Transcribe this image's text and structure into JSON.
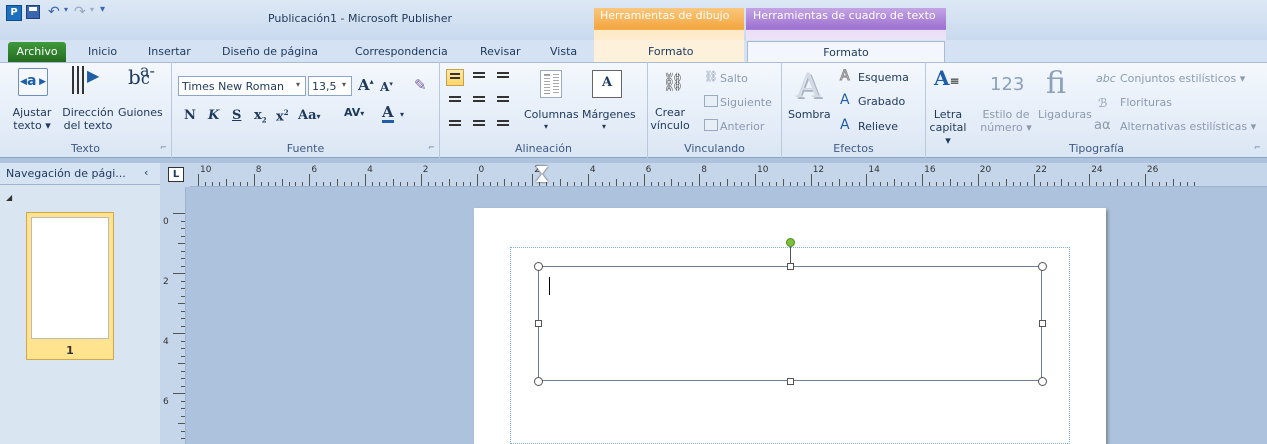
{
  "window": {
    "title": "Publicación1 - Microsoft Publisher"
  },
  "contextual": {
    "drawing_tools": "Herramientas de dibujo",
    "textbox_tools": "Herramientas de cuadro de texto"
  },
  "tabs": {
    "file": "Archivo",
    "home": "Inicio",
    "insert": "Insertar",
    "page_design": "Diseño de página",
    "mailings": "Correspondencia",
    "review": "Revisar",
    "view": "Vista",
    "format_drawing": "Formato",
    "format_textbox": "Formato"
  },
  "ribbon": {
    "texto": {
      "label": "Texto",
      "fit": "Ajustar texto ▾",
      "direction": "Dirección del texto",
      "hyphen": "Guiones"
    },
    "fuente": {
      "label": "Fuente",
      "font_name": "Times New Roman",
      "font_size": "13,5"
    },
    "alineacion": {
      "label": "Alineación",
      "columns": "Columnas",
      "margins": "Márgenes"
    },
    "vinculando": {
      "label": "Vinculando",
      "create_link": "Crear vínculo",
      "jump": "Salto",
      "next": "Siguiente",
      "previous": "Anterior"
    },
    "efectos": {
      "label": "Efectos",
      "shadow": "Sombra",
      "outline": "Esquema",
      "engrave": "Grabado",
      "emboss": "Relieve"
    },
    "tipografia": {
      "label": "Tipografía",
      "dropcap": "Letra capital ▾",
      "number_style": "Estilo de número ▾",
      "ligatures": "Ligaduras",
      "stylistic_sets": "Conjuntos estilísticos ▾",
      "swashes": "Florituras",
      "stylistic_alternates": "Alternativas estilísticas ▾"
    }
  },
  "nav": {
    "title": "Navegación de pági...",
    "page_number": "1"
  },
  "ruler": {
    "h_labels": [
      "10",
      "8",
      "6",
      "4",
      "2",
      "0",
      "2",
      "4",
      "6",
      "8",
      "10",
      "12",
      "14",
      "16",
      "20",
      "22",
      "24",
      "26"
    ],
    "v_labels": [
      "0",
      "2",
      "4",
      "6"
    ]
  },
  "colors": {
    "file_tab": "#2e8b2c",
    "drawing_tools": "#f4a53d",
    "textbox_tools": "#9b6fcf",
    "rotation_handle": "#7cc23a"
  }
}
